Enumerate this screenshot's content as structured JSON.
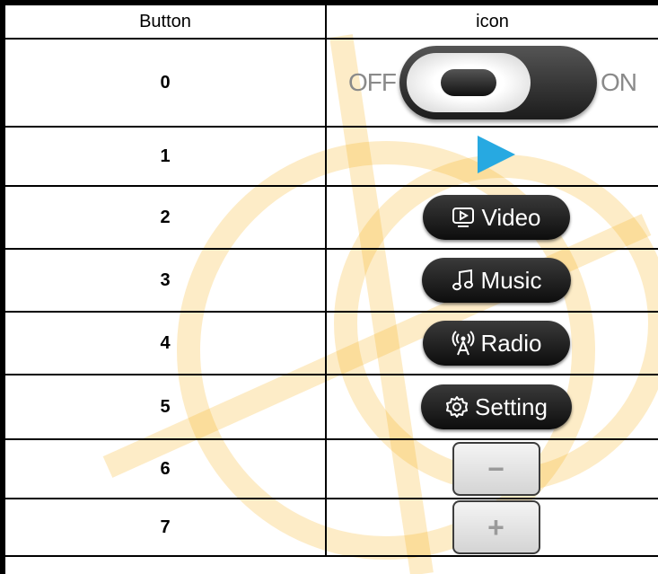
{
  "table": {
    "headers": [
      "Button",
      "icon"
    ],
    "rows": [
      {
        "button": "0",
        "icon": "toggle-switch-icon",
        "off_label": "OFF",
        "on_label": "ON"
      },
      {
        "button": "1",
        "icon": "play-icon"
      },
      {
        "button": "2",
        "icon": "video-button",
        "label": "Video",
        "glyph": "monitor-play-icon"
      },
      {
        "button": "3",
        "icon": "music-button",
        "label": "Music",
        "glyph": "music-note-icon"
      },
      {
        "button": "4",
        "icon": "radio-button",
        "label": "Radio",
        "glyph": "antenna-icon"
      },
      {
        "button": "5",
        "icon": "setting-button",
        "label": "Setting",
        "glyph": "gear-icon"
      },
      {
        "button": "6",
        "icon": "minus-button",
        "symbol": "−"
      },
      {
        "button": "7",
        "icon": "plus-button",
        "symbol": "+"
      }
    ]
  },
  "colors": {
    "play": "#27a9e1",
    "pill_dark": "#111111",
    "watermark": "#f7a800"
  }
}
